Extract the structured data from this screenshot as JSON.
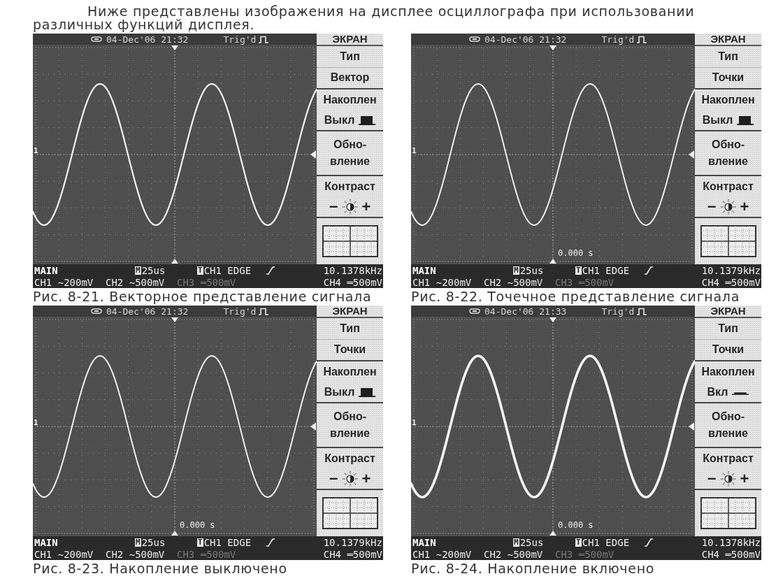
{
  "intro": "Ниже представлены изображения на дисплее осциллографа при использовании различных функций дисплея.",
  "figures": [
    {
      "kind": "vector",
      "caption": "Рис. 8-21. Векторное представление сигнала",
      "screen": {
        "date": "04-Dec'06 21:32",
        "trigger_status": "Trig'd",
        "channel_marker": "1",
        "menu": {
          "title": "ЭКРАН",
          "type_label": "Тип",
          "type_value": "Вектор",
          "persist_label": "Накоплен",
          "persist_value": "Выкл",
          "persist_on": false,
          "refresh_label": "Обно-вление",
          "contrast_label": "Контраст",
          "contrast_minus": "−",
          "contrast_plus": "+"
        },
        "status": {
          "mode": "MAIN",
          "timebase_tag": "M",
          "timebase": "25us",
          "trigger_tag": "T",
          "trigger": "CH1 EDGE",
          "frequency": "10.1378kHz"
        },
        "channels": [
          {
            "name": "CH1",
            "coupling": "∼",
            "scale": "200mV",
            "disabled": false
          },
          {
            "name": "CH2",
            "coupling": "∼",
            "scale": "500mV",
            "disabled": false
          },
          {
            "name": "CH3",
            "coupling": "═",
            "scale": "500mV",
            "disabled": true
          },
          {
            "name": "CH4",
            "coupling": "═",
            "scale": "500mV",
            "disabled": false
          }
        ]
      }
    },
    {
      "kind": "dots",
      "caption": "Рис. 8-22. Точечное представление сигнала",
      "screen": {
        "date": "04-Dec'06 21:32",
        "trigger_status": "Trig'd",
        "channel_marker": "1",
        "time_marker": "0.000 s",
        "menu": {
          "title": "ЭКРАН",
          "type_label": "Тип",
          "type_value": "Точки",
          "persist_label": "Накоплен",
          "persist_value": "Выкл",
          "persist_on": false,
          "refresh_label": "Обно-вление",
          "contrast_label": "Контраст",
          "contrast_minus": "−",
          "contrast_plus": "+"
        },
        "status": {
          "mode": "MAIN",
          "timebase_tag": "M",
          "timebase": "25us",
          "trigger_tag": "T",
          "trigger": "CH1 EDGE",
          "frequency": "10.1379kHz"
        },
        "channels": [
          {
            "name": "CH1",
            "coupling": "∼",
            "scale": "200mV",
            "disabled": false
          },
          {
            "name": "CH2",
            "coupling": "∼",
            "scale": "500mV",
            "disabled": false
          },
          {
            "name": "CH3",
            "coupling": "═",
            "scale": "500mV",
            "disabled": true
          },
          {
            "name": "CH4",
            "coupling": "═",
            "scale": "500mV",
            "disabled": false
          }
        ]
      }
    },
    {
      "kind": "dots",
      "caption": "Рис. 8-23. Накопление выключено",
      "screen": {
        "date": "04-Dec'06 21:32",
        "trigger_status": "Trig'd",
        "channel_marker": "1",
        "time_marker": "0.000 s",
        "menu": {
          "title": "ЭКРАН",
          "type_label": "Тип",
          "type_value": "Точки",
          "persist_label": "Накоплен",
          "persist_value": "Выкл",
          "persist_on": false,
          "refresh_label": "Обно-вление",
          "contrast_label": "Контраст",
          "contrast_minus": "−",
          "contrast_plus": "+"
        },
        "status": {
          "mode": "MAIN",
          "timebase_tag": "M",
          "timebase": "25us",
          "trigger_tag": "T",
          "trigger": "CH1 EDGE",
          "frequency": "10.1379kHz"
        },
        "channels": [
          {
            "name": "CH1",
            "coupling": "∼",
            "scale": "200mV",
            "disabled": false
          },
          {
            "name": "CH2",
            "coupling": "∼",
            "scale": "500mV",
            "disabled": false
          },
          {
            "name": "CH3",
            "coupling": "═",
            "scale": "500mV",
            "disabled": true
          },
          {
            "name": "CH4",
            "coupling": "═",
            "scale": "500mV",
            "disabled": false
          }
        ]
      }
    },
    {
      "kind": "dots",
      "caption": "Рис. 8-24. Накопление включено",
      "screen": {
        "date": "04-Dec'06 21:33",
        "trigger_status": "Trig'd",
        "channel_marker": "1",
        "time_marker": "0.000 s",
        "menu": {
          "title": "ЭКРАН",
          "type_label": "Тип",
          "type_value": "Точки",
          "persist_label": "Накоплен",
          "persist_value": "Вкл",
          "persist_on": true,
          "refresh_label": "Обно-вление",
          "contrast_label": "Контраст",
          "contrast_minus": "−",
          "contrast_plus": "+"
        },
        "status": {
          "mode": "MAIN",
          "timebase_tag": "M",
          "timebase": "25us",
          "trigger_tag": "T",
          "trigger": "CH1 EDGE",
          "frequency": "10.1378kHz"
        },
        "channels": [
          {
            "name": "CH1",
            "coupling": "∼",
            "scale": "200mV",
            "disabled": false
          },
          {
            "name": "CH2",
            "coupling": "∼",
            "scale": "500mV",
            "disabled": false
          },
          {
            "name": "CH3",
            "coupling": "═",
            "scale": "500mV",
            "disabled": true
          },
          {
            "name": "CH4",
            "coupling": "═",
            "scale": "500mV",
            "disabled": false
          }
        ]
      }
    }
  ]
}
